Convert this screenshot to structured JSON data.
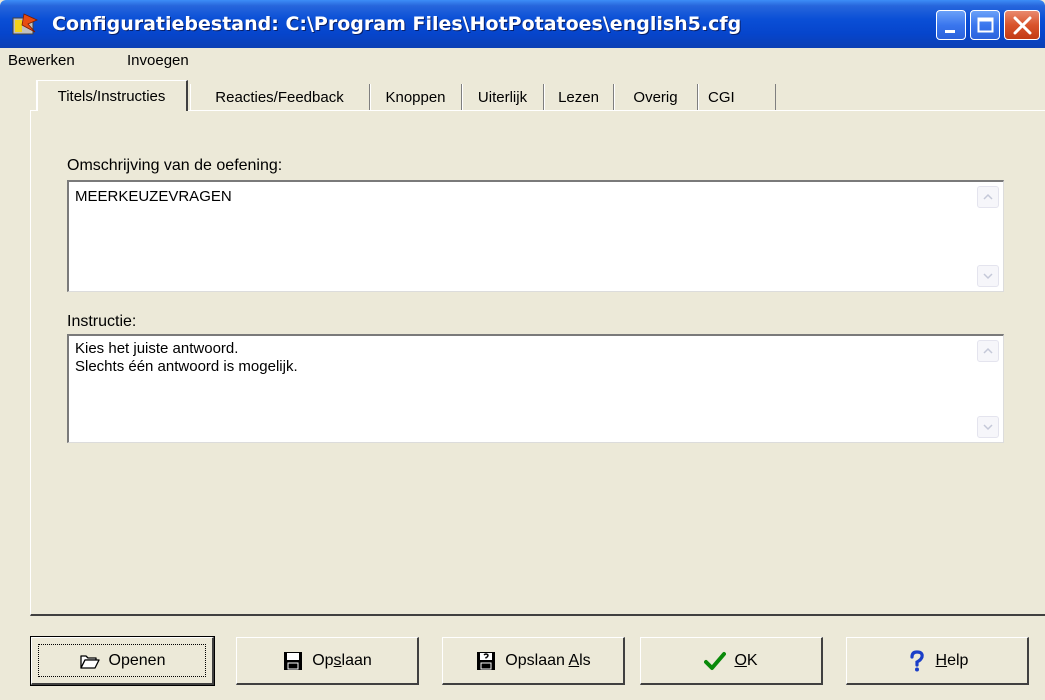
{
  "window": {
    "title": "Configuratiebestand: C:\\Program Files\\HotPotatoes\\english5.cfg",
    "colors": {
      "titlebar": "#0a4fd6",
      "face": "#ece9d8",
      "close": "#d9542c"
    }
  },
  "menu": [
    {
      "label": "Bewerken"
    },
    {
      "label": "Invoegen"
    }
  ],
  "tabs": [
    {
      "label": "Titels/Instructies",
      "active": true
    },
    {
      "label": "Reacties/Feedback"
    },
    {
      "label": "Knoppen"
    },
    {
      "label": "Uiterlijk"
    },
    {
      "label": "Lezen"
    },
    {
      "label": "Overig"
    },
    {
      "label": "CGI"
    }
  ],
  "fields": {
    "description": {
      "label": "Omschrijving van de oefening:",
      "lines": [
        "MEERKEUZEVRAGEN"
      ]
    },
    "instruction": {
      "label": "Instructie:",
      "lines": [
        "Kies het juiste antwoord.",
        "Slechts één antwoord is mogelijk."
      ]
    }
  },
  "buttons": {
    "open": {
      "label": "Openen",
      "icon": "folder-open-icon"
    },
    "save": {
      "pre": "Op",
      "accel": "s",
      "post": "laan",
      "icon": "floppy-disk-icon"
    },
    "save_as": {
      "pre": "Opslaan ",
      "accel": "A",
      "post": "ls",
      "icon": "save-as-icon"
    },
    "ok": {
      "accel": "O",
      "post": "K",
      "icon": "checkmark-icon"
    },
    "help": {
      "accel": "H",
      "post": "elp",
      "icon": "question-mark-icon"
    }
  }
}
